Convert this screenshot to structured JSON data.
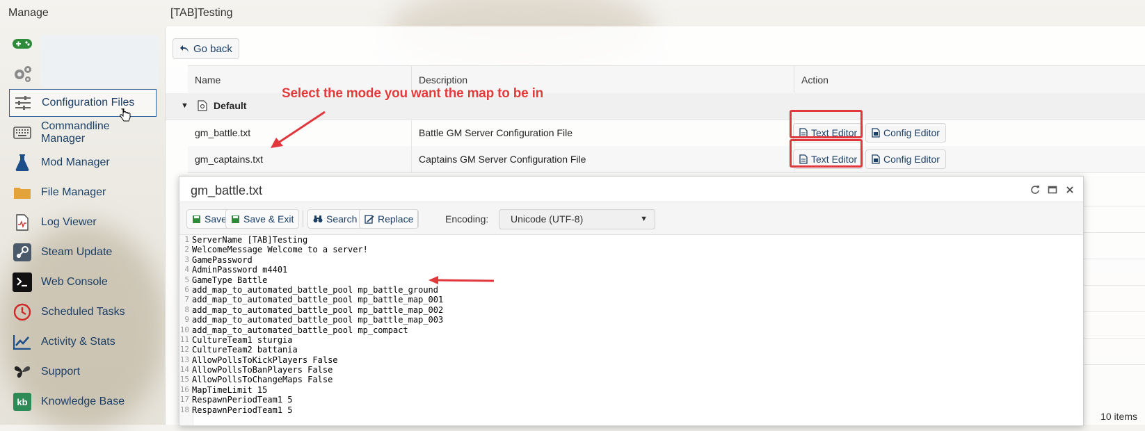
{
  "header": {
    "manage": "Manage",
    "title": "[TAB]Testing"
  },
  "sidebar": {
    "items": [
      {
        "label": "Configuration Files",
        "icon": "sliders-icon"
      },
      {
        "label": "Commandline Manager",
        "icon": "keyboard-icon"
      },
      {
        "label": "Mod Manager",
        "icon": "flask-icon"
      },
      {
        "label": "File Manager",
        "icon": "folder-icon"
      },
      {
        "label": "Log Viewer",
        "icon": "log-icon"
      },
      {
        "label": "Steam Update",
        "icon": "steam-icon"
      },
      {
        "label": "Web Console",
        "icon": "terminal-icon"
      },
      {
        "label": "Scheduled Tasks",
        "icon": "clock-icon"
      },
      {
        "label": "Activity & Stats",
        "icon": "chart-icon"
      },
      {
        "label": "Support",
        "icon": "butterfly-icon"
      },
      {
        "label": "Knowledge Base",
        "icon": "kb-icon"
      }
    ]
  },
  "main": {
    "go_back": "Go back",
    "columns": [
      "Name",
      "Description",
      "Action"
    ],
    "group": "Default",
    "rows": [
      {
        "name": "gm_battle.txt",
        "description": "Battle GM Server Configuration File",
        "text_editor": "Text Editor",
        "config_editor": "Config Editor"
      },
      {
        "name": "gm_captains.txt",
        "description": "Captains GM Server Configuration File",
        "text_editor": "Text Editor",
        "config_editor": "Config Editor"
      }
    ],
    "items_count": "10 items",
    "annotation": "Select the mode you want the map to be in"
  },
  "editor": {
    "title": "gm_battle.txt",
    "toolbar": {
      "save": "Save",
      "save_exit": "Save & Exit",
      "search": "Search",
      "replace": "Replace",
      "encoding_label": "Encoding:",
      "encoding_value": "Unicode (UTF-8)"
    },
    "lines": [
      "ServerName [TAB]Testing",
      "WelcomeMessage Welcome to a server!",
      "GamePassword",
      "AdminPassword m4401",
      "GameType Battle",
      "add_map_to_automated_battle_pool mp_battle_ground",
      "add_map_to_automated_battle_pool mp_battle_map_001",
      "add_map_to_automated_battle_pool mp_battle_map_002",
      "add_map_to_automated_battle_pool mp_battle_map_003",
      "add_map_to_automated_battle_pool mp_compact",
      "CultureTeam1 sturgia",
      "CultureTeam2 battania",
      "AllowPollsToKickPlayers False",
      "AllowPollsToBanPlayers False",
      "AllowPollsToChangeMaps False",
      "MapTimeLimit 15",
      "RespawnPeriodTeam1 5",
      "RespawnPeriodTeam1 5"
    ]
  },
  "colors": {
    "accent": "#1c3f66",
    "highlight": "#e0363c"
  }
}
